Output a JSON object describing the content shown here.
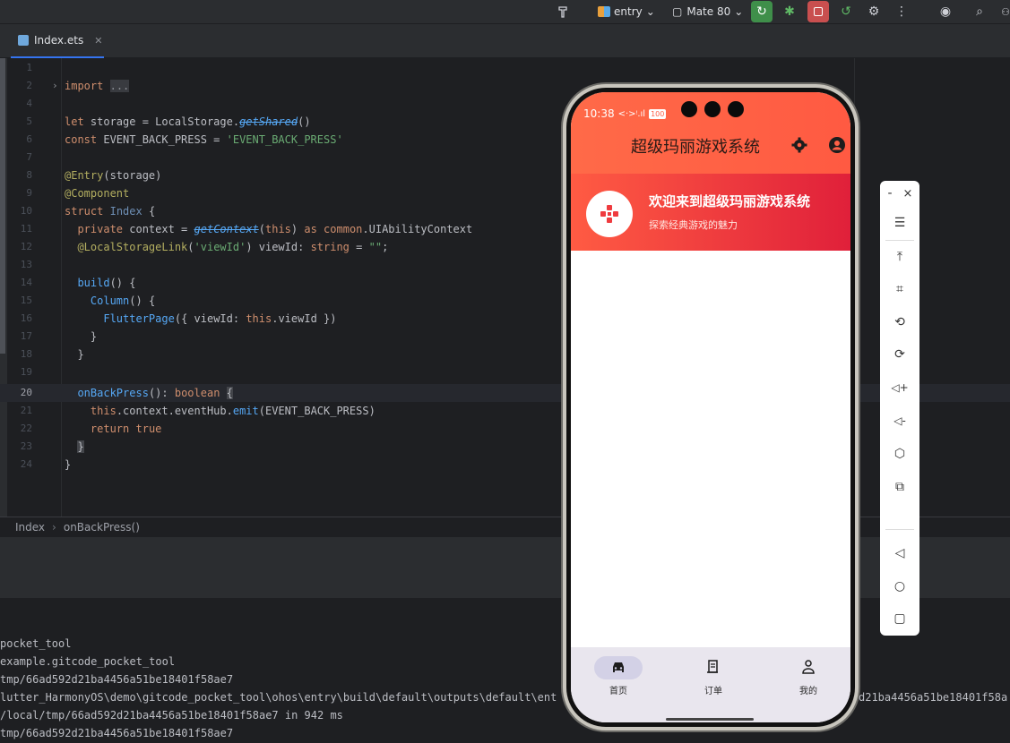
{
  "toolbar": {
    "module": "entry",
    "device": "Mate 80"
  },
  "tabs": [
    {
      "label": "Index.ets"
    }
  ],
  "editor": {
    "line_numbers": [
      "1",
      "2",
      "4",
      "5",
      "6",
      "7",
      "8",
      "9",
      "10",
      "11",
      "12",
      "13",
      "14",
      "15",
      "16",
      "17",
      "18",
      "19",
      "20",
      "21",
      "22",
      "23",
      "24"
    ],
    "current_line": "20"
  },
  "breadcrumb": {
    "items": [
      "Index",
      "onBackPress()"
    ]
  },
  "console": {
    "lines": [
      "pocket_tool",
      "example.gitcode_pocket_tool",
      "tmp/66ad592d21ba4456a51be18401f58ae7",
      "lutter_HarmonyOS\\demo\\gitcode_pocket_tool\\ohos\\entry\\build\\default\\outputs\\default\\ent",
      "/local/tmp/66ad592d21ba4456a51be18401f58ae7 in 942 ms",
      "tmp/66ad592d21ba4456a51be18401f58ae7"
    ],
    "overflow_text": "d21ba4456a51be18401f58a"
  },
  "phone": {
    "status_time": "10:38",
    "status_icons": "<·>ᵎ.ıl",
    "battery": "100",
    "app_title": "超级玛丽游戏系统",
    "banner_title": "欢迎来到超级玛丽游戏系统",
    "banner_subtitle": "探索经典游戏的魅力",
    "nav": [
      {
        "label": "首页",
        "icon": "car-icon",
        "active": true
      },
      {
        "label": "订单",
        "icon": "receipt-icon",
        "active": false
      },
      {
        "label": "我的",
        "icon": "person-icon",
        "active": false
      }
    ],
    "colors": {
      "header": "#ff5f45",
      "banner_end": "#e0203a",
      "nav_bg": "#e9e6ee",
      "active_pill": "#d3d1e6"
    }
  },
  "floatbar": {
    "minimize": "-",
    "close": "×"
  }
}
